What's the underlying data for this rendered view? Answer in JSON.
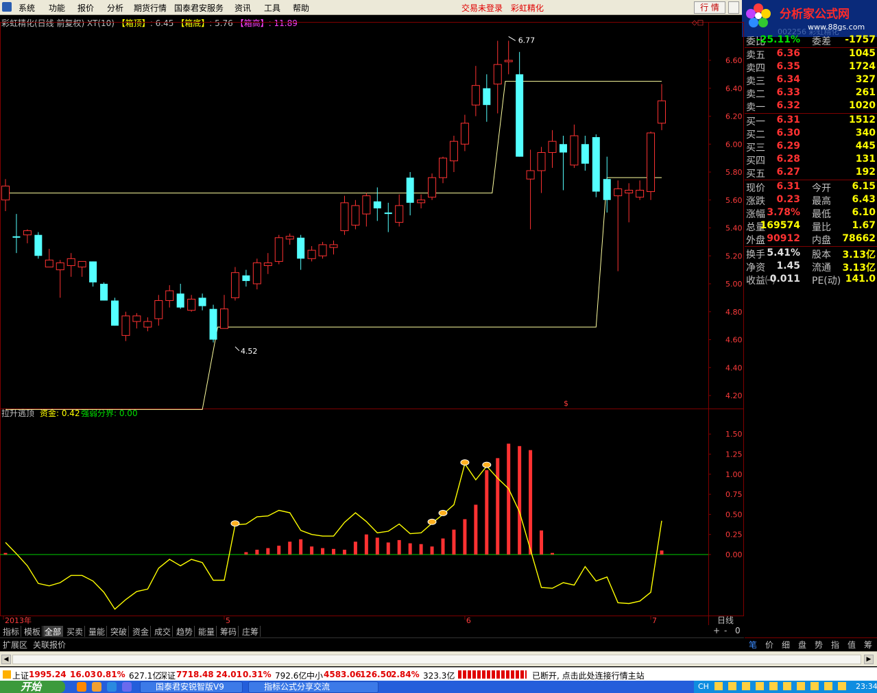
{
  "menu": {
    "items": [
      "系统",
      "功能",
      "报价",
      "分析",
      "期货行情",
      "国泰君安服务",
      "资讯",
      "工具",
      "帮助"
    ],
    "login_status": "交易未登录",
    "product_name": "彩虹精化",
    "quote_button": "行 情"
  },
  "logo": {
    "brand": "分析家公式网",
    "site": "www.88gs.com",
    "ghost_text": "002256 彩虹精化"
  },
  "chart_header": {
    "title": "彩虹精化(日线 前复权) XT(10)",
    "box_top_label": "【箱顶】",
    "box_top_value": ": 6.45",
    "box_bottom_label": "【箱底】",
    "box_bottom_value": ": 5.76",
    "box_high_label": "【箱高】",
    "box_high_value": ": 11.89"
  },
  "chart_data": [
    {
      "type": "candlestick",
      "title": "彩虹精化(日线 前复权)",
      "ylim": [
        4.05,
        6.85
      ],
      "y_ticks": [
        "6.60",
        "6.40",
        "6.20",
        "6.00",
        "5.80",
        "5.60",
        "5.40",
        "5.20",
        "5.00",
        "4.80",
        "4.60",
        "4.40",
        "4.20"
      ],
      "annotations": {
        "high": "6.77",
        "low": "4.52"
      },
      "candles": [
        [
          5.6,
          5.7,
          5.75,
          5.52
        ],
        [
          5.34,
          5.33,
          5.5,
          5.22
        ],
        [
          5.35,
          5.38,
          5.39,
          5.29
        ],
        [
          5.35,
          5.2,
          5.37,
          5.18
        ],
        [
          5.12,
          5.17,
          5.25,
          5.12
        ],
        [
          5.1,
          5.15,
          5.17,
          4.9
        ],
        [
          5.13,
          5.18,
          5.22,
          5.05
        ],
        [
          5.12,
          5.16,
          5.16,
          5.05
        ],
        [
          5.16,
          5.01,
          5.16,
          4.98
        ],
        [
          5.0,
          4.88,
          5.01,
          4.88
        ],
        [
          4.88,
          4.7,
          4.9,
          4.7
        ],
        [
          4.63,
          4.77,
          4.8,
          4.59
        ],
        [
          4.73,
          4.77,
          4.79,
          4.68
        ],
        [
          4.69,
          4.73,
          4.76,
          4.66
        ],
        [
          4.75,
          4.88,
          4.92,
          4.7
        ],
        [
          4.88,
          4.95,
          4.99,
          4.83
        ],
        [
          4.93,
          4.83,
          5.0,
          4.82
        ],
        [
          4.81,
          4.89,
          4.92,
          4.8
        ],
        [
          4.9,
          4.84,
          4.93,
          4.81
        ],
        [
          4.82,
          4.6,
          4.85,
          4.58
        ],
        [
          4.68,
          4.82,
          4.92,
          4.68
        ],
        [
          4.9,
          5.08,
          5.12,
          4.88
        ],
        [
          5.06,
          5.02,
          5.1,
          4.98
        ],
        [
          5.0,
          5.15,
          5.18,
          4.96
        ],
        [
          5.13,
          5.15,
          5.22,
          5.07
        ],
        [
          5.16,
          5.33,
          5.35,
          5.14
        ],
        [
          5.32,
          5.34,
          5.36,
          5.28
        ],
        [
          5.33,
          5.18,
          5.35,
          5.1
        ],
        [
          5.18,
          5.24,
          5.27,
          5.16
        ],
        [
          5.2,
          5.28,
          5.3,
          5.18
        ],
        [
          5.26,
          5.28,
          5.31,
          5.21
        ],
        [
          5.38,
          5.58,
          5.63,
          5.35
        ],
        [
          5.42,
          5.56,
          5.6,
          5.39
        ],
        [
          5.5,
          5.63,
          5.65,
          5.41
        ],
        [
          5.59,
          5.54,
          5.69,
          5.45
        ],
        [
          5.51,
          5.5,
          5.58,
          5.37
        ],
        [
          5.44,
          5.56,
          5.64,
          5.41
        ],
        [
          5.76,
          5.58,
          5.8,
          5.49
        ],
        [
          5.58,
          5.6,
          5.64,
          5.54
        ],
        [
          5.62,
          5.76,
          5.79,
          5.6
        ],
        [
          5.76,
          5.9,
          5.91,
          5.72
        ],
        [
          5.88,
          6.02,
          6.06,
          5.8
        ],
        [
          6.0,
          6.15,
          6.21,
          5.95
        ],
        [
          6.28,
          6.42,
          6.56,
          6.2
        ],
        [
          6.4,
          6.28,
          6.5,
          6.16
        ],
        [
          6.43,
          6.57,
          6.74,
          6.22
        ],
        [
          6.59,
          6.6,
          6.74,
          6.5
        ],
        [
          6.5,
          5.91,
          6.66,
          5.91
        ],
        [
          5.75,
          5.81,
          5.96,
          5.39
        ],
        [
          5.81,
          5.94,
          5.98,
          5.65
        ],
        [
          5.94,
          6.02,
          6.1,
          5.83
        ],
        [
          6.0,
          5.94,
          6.06,
          5.67
        ],
        [
          5.85,
          6.06,
          6.14,
          5.83
        ],
        [
          6.0,
          5.86,
          6.06,
          5.81
        ],
        [
          6.05,
          5.66,
          6.07,
          5.62
        ],
        [
          5.75,
          5.6,
          5.91,
          5.51
        ],
        [
          5.63,
          5.68,
          5.74,
          5.09
        ],
        [
          5.65,
          5.67,
          5.72,
          5.44
        ],
        [
          5.62,
          5.67,
          5.74,
          5.6
        ],
        [
          5.66,
          6.08,
          6.09,
          5.6
        ],
        [
          6.15,
          6.31,
          6.43,
          6.1
        ]
      ],
      "box_line": [
        {
          "from": 0,
          "to": 42,
          "value": 5.65
        },
        {
          "from": 42,
          "to": 43,
          "value": 6.45
        },
        {
          "from": 43,
          "to": 59,
          "value": 6.45
        },
        {
          "from": 61,
          "to": 61,
          "value": 6.45
        }
      ]
    },
    {
      "type": "bar+line",
      "title": "拉升逃顶",
      "series_labels": [
        "资金: 0.42",
        "强弱分界: 0.00"
      ],
      "ylim": [
        -0.75,
        1.75
      ],
      "y_ticks": [
        "1.50",
        "1.25",
        "1.00",
        "0.75",
        "0.50",
        "0.25",
        "0.00"
      ],
      "bars": [
        0.02,
        0,
        0,
        0,
        0,
        0,
        0,
        0,
        0,
        0,
        0,
        0,
        0,
        0,
        0,
        0,
        0,
        0,
        0,
        0,
        0,
        0,
        0.03,
        0.06,
        0.08,
        0.11,
        0.16,
        0.19,
        0.1,
        0.08,
        0.07,
        0.06,
        0.16,
        0.25,
        0.21,
        0.15,
        0.18,
        0.14,
        0.13,
        0.1,
        0.2,
        0.31,
        0.44,
        0.62,
        1.05,
        1.2,
        1.38,
        1.35,
        1.3,
        0.3,
        0.02,
        0,
        0,
        0,
        0,
        0,
        0,
        0,
        0,
        0,
        0.05
      ],
      "line": [
        0.15,
        0.01,
        -0.14,
        -0.36,
        -0.39,
        -0.35,
        -0.26,
        -0.26,
        -0.33,
        -0.47,
        -0.68,
        -0.56,
        -0.46,
        -0.43,
        -0.17,
        -0.06,
        -0.14,
        -0.06,
        -0.1,
        -0.32,
        -0.32,
        0.37,
        0.38,
        0.47,
        0.48,
        0.55,
        0.52,
        0.3,
        0.25,
        0.23,
        0.23,
        0.4,
        0.52,
        0.41,
        0.27,
        0.29,
        0.38,
        0.26,
        0.27,
        0.39,
        0.5,
        0.62,
        1.13,
        0.93,
        1.1,
        0.95,
        0.82,
        0.53,
        0.06,
        -0.41,
        -0.42,
        -0.35,
        -0.38,
        -0.15,
        -0.33,
        -0.28,
        -0.6,
        -0.61,
        -0.58,
        -0.47,
        0.42
      ],
      "markers": [
        21,
        39,
        40,
        42,
        44
      ],
      "x_ticks": [
        {
          "index": 0,
          "label": "2013年"
        },
        {
          "index": 20,
          "label": "5"
        },
        {
          "index": 42,
          "label": "6"
        },
        {
          "index": 59,
          "label": "7"
        }
      ]
    }
  ],
  "indicator_label": "拉升逃顶",
  "indicator_fund": "资金: 0.42",
  "indicator_boundary": "强弱分界: 0.00",
  "period_label": "日线",
  "zoom": {
    "plus": "+",
    "minus": "-",
    "zero": "0"
  },
  "quote": {
    "ratio_label": "委比",
    "ratio_value": "-25.11%",
    "diff_label": "委差",
    "diff_value": "-1757",
    "asks": [
      {
        "label": "卖五",
        "price": "6.36",
        "vol": "1045"
      },
      {
        "label": "卖四",
        "price": "6.35",
        "vol": "1724"
      },
      {
        "label": "卖三",
        "price": "6.34",
        "vol": "327"
      },
      {
        "label": "卖二",
        "price": "6.33",
        "vol": "261"
      },
      {
        "label": "卖一",
        "price": "6.32",
        "vol": "1020"
      }
    ],
    "bids": [
      {
        "label": "买一",
        "price": "6.31",
        "vol": "1512"
      },
      {
        "label": "买二",
        "price": "6.30",
        "vol": "340"
      },
      {
        "label": "买三",
        "price": "6.29",
        "vol": "445"
      },
      {
        "label": "买四",
        "price": "6.28",
        "vol": "131"
      },
      {
        "label": "买五",
        "price": "6.27",
        "vol": "192"
      }
    ],
    "stats": [
      {
        "l1": "现价",
        "v1": "6.31",
        "c1": "red",
        "l2": "今开",
        "v2": "6.15",
        "c2": "red"
      },
      {
        "l1": "涨跌",
        "v1": "0.23",
        "c1": "red",
        "l2": "最高",
        "v2": "6.43",
        "c2": "red"
      },
      {
        "l1": "涨幅",
        "v1": "3.78%",
        "c1": "red",
        "l2": "最低",
        "v2": "6.10",
        "c2": "red"
      },
      {
        "l1": "总量",
        "v1": "169574",
        "c1": "yel",
        "l2": "量比",
        "v2": "1.67",
        "c2": "red"
      },
      {
        "l1": "外盘",
        "v1": "90912",
        "c1": "red",
        "l2": "内盘",
        "v2": "78662",
        "c2": "grn"
      }
    ],
    "stats2": [
      {
        "l1": "换手",
        "v1": "5.41%",
        "l2": "股本",
        "v2": "3.13亿"
      },
      {
        "l1": "净资",
        "v1": "1.45",
        "l2": "流通",
        "v2": "3.13亿"
      },
      {
        "l1": "收益㈠",
        "v1": "0.011",
        "l2": "PE(动)",
        "v2": "141.0"
      }
    ]
  },
  "indicator_tabs": [
    "指标",
    "模板",
    "全部",
    "买卖",
    "量能",
    "突破",
    "资金",
    "成交",
    "趋势",
    "能量",
    "筹码",
    "庄筹"
  ],
  "active_tab": "全部",
  "ext_bar": [
    "扩展区",
    "关联报价"
  ],
  "right_tabs": [
    "笔",
    "价",
    "细",
    "盘",
    "势",
    "指",
    "值",
    "筹"
  ],
  "index_bar": {
    "sh_label": "上证",
    "sh_value": "1995.24",
    "sh_chg": "16.03",
    "sh_pct": "0.81%",
    "sh_amt": "627.1亿",
    "sz_label": "深证",
    "sz_value": "7718.48",
    "sz_chg": "24.01",
    "sz_pct": "0.31%",
    "sz_amt": "792.6亿",
    "sme_label": "中小",
    "sme_value": "4583.06",
    "sme_chg": "126.50",
    "sme_pct": "2.84%",
    "sme_amt": "323.3亿",
    "message": "已断开, 点击此处连接行情主站"
  },
  "taskbar": {
    "start": "开始",
    "tasks": [
      "国泰君安锐智版V9",
      "指标公式分享交流"
    ],
    "clock": "23:34",
    "lang": "CH"
  },
  "colors": {
    "up": "#ff3232",
    "down": "#54ffff",
    "box_line": "#ffffa0",
    "indicator_line": "#ffff00",
    "zero_line": "#00d000",
    "grid": "#800000"
  }
}
